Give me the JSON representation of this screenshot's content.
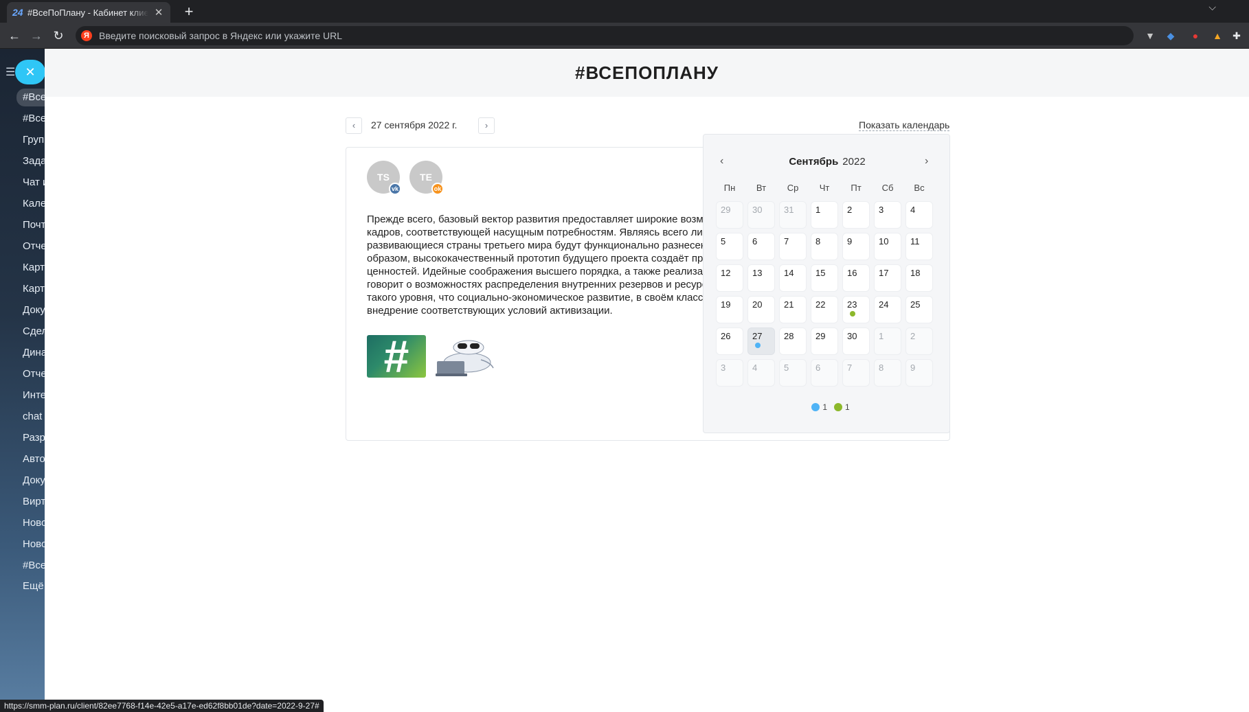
{
  "browser": {
    "tab_favicon": "24",
    "tab_title": "#ВсеПоПлану - Кабинет клиента",
    "tab_close": "✕",
    "new_tab": "+",
    "tab_menu": "⌵",
    "back": "←",
    "forward": "→",
    "reload": "↻",
    "search_engine_icon": "Я",
    "address_placeholder": "Введите поисковый запрос в Яндекс или укажите URL",
    "status_url": "https://smm-plan.ru/client/82ee7768-f14e-42e5-a17e-ed62f8bb01de?date=2022-9-27#"
  },
  "sidebar": {
    "close_icon": "✕",
    "items": [
      {
        "label": "#ВсеПоПлану"
      },
      {
        "label": "#ВсеПоПлану"
      },
      {
        "label": "Группы"
      },
      {
        "label": "Задачи"
      },
      {
        "label": "Чат и звонки"
      },
      {
        "label": "Календарь"
      },
      {
        "label": "Почта"
      },
      {
        "label": "Отчеты"
      },
      {
        "label": "Карты"
      },
      {
        "label": "Карточки"
      },
      {
        "label": "Документы"
      },
      {
        "label": "Сделки"
      },
      {
        "label": "Динамика"
      },
      {
        "label": "Отчеты"
      },
      {
        "label": "Интеграции"
      },
      {
        "label": "chat"
      },
      {
        "label": "Разработчикам"
      },
      {
        "label": "Автоматизация"
      },
      {
        "label": "Документы"
      },
      {
        "label": "Виртуальная"
      },
      {
        "label": "Новости"
      },
      {
        "label": "Новости"
      },
      {
        "label": "#ВсеПоПлану"
      },
      {
        "label": "Ещё"
      }
    ]
  },
  "header": {
    "title": "#ВСЕПОПЛАНУ"
  },
  "date_nav": {
    "prev": "‹",
    "next": "›",
    "current_date": "27 сентября 2022 г.",
    "show_calendar": "Показать календарь"
  },
  "post": {
    "avatars": [
      {
        "initials": "TS",
        "network": "vk",
        "badge": "vk",
        "badge_color": "#4a76a8"
      },
      {
        "initials": "TE",
        "network": "ok",
        "badge": "ok",
        "badge_color": "#f7931e"
      }
    ],
    "text_lines": [
      "Прежде всего, базовый вектор развития предоставляет широкие возможности для",
      "кадров, соответствующей насущным потребностям. Являясь всего лишь частью",
      "развивающиеся страны третьего мира будут функционально разнесены на",
      "образом, высококачественный прототип будущего проекта создаёт предпосылки для",
      "ценностей. Идейные соображения высшего порядка, а также реализация намеченных",
      "говорит о возможностях распределения внутренних резервов и ресурсов",
      "такого уровня, что социально-экономическое развитие, в своём классическом",
      "внедрение соответствующих условий активизации."
    ],
    "image_hash_symbol": "#"
  },
  "calendar": {
    "prev": "‹",
    "next": "›",
    "month": "Сентябрь",
    "year": "2022",
    "weekdays": [
      "Пн",
      "Вт",
      "Ср",
      "Чт",
      "Пт",
      "Сб",
      "Вс"
    ],
    "weeks": [
      [
        {
          "d": "29",
          "o": true
        },
        {
          "d": "30",
          "o": true
        },
        {
          "d": "31",
          "o": true
        },
        {
          "d": "1"
        },
        {
          "d": "2"
        },
        {
          "d": "3"
        },
        {
          "d": "4"
        }
      ],
      [
        {
          "d": "5"
        },
        {
          "d": "6"
        },
        {
          "d": "7"
        },
        {
          "d": "8"
        },
        {
          "d": "9"
        },
        {
          "d": "10"
        },
        {
          "d": "11"
        }
      ],
      [
        {
          "d": "12"
        },
        {
          "d": "13"
        },
        {
          "d": "14"
        },
        {
          "d": "15"
        },
        {
          "d": "16"
        },
        {
          "d": "17"
        },
        {
          "d": "18"
        }
      ],
      [
        {
          "d": "19"
        },
        {
          "d": "20"
        },
        {
          "d": "21"
        },
        {
          "d": "22"
        },
        {
          "d": "23",
          "dot": "#8cb82b"
        },
        {
          "d": "24"
        },
        {
          "d": "25"
        }
      ],
      [
        {
          "d": "26"
        },
        {
          "d": "27",
          "selected": true,
          "dot": "#4fb3f6"
        },
        {
          "d": "28"
        },
        {
          "d": "29"
        },
        {
          "d": "30"
        },
        {
          "d": "1",
          "o": true
        },
        {
          "d": "2",
          "o": true
        }
      ],
      [
        {
          "d": "3",
          "o": true
        },
        {
          "d": "4",
          "o": true
        },
        {
          "d": "5",
          "o": true
        },
        {
          "d": "6",
          "o": true
        },
        {
          "d": "7",
          "o": true
        },
        {
          "d": "8",
          "o": true
        },
        {
          "d": "9",
          "o": true
        }
      ]
    ],
    "legend": [
      {
        "color": "#4fb3f6",
        "count": "1"
      },
      {
        "color": "#8cb82b",
        "count": "1"
      }
    ]
  }
}
